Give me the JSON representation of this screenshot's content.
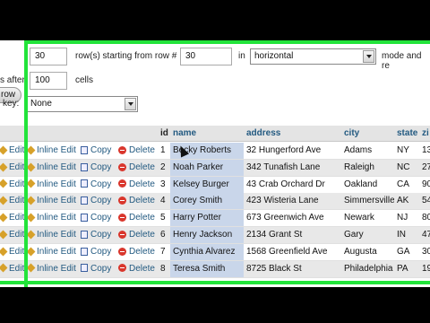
{
  "controls": {
    "nav_button": "row",
    "rows_value": "30",
    "rows_label": "row(s) starting from row #",
    "start_value": "30",
    "in_label": "in",
    "mode_value": "horizontal",
    "mode_label": "mode and re",
    "repeat_left_label": "s after",
    "repeat_value": "100",
    "cells_label": "cells",
    "key_label": "key:",
    "key_value": "None"
  },
  "table": {
    "headers": [
      "id",
      "name",
      "address",
      "city",
      "state",
      "zi"
    ],
    "action_labels": {
      "edit": "Edit",
      "inline_edit": "Inline Edit",
      "copy": "Copy",
      "delete": "Delete"
    },
    "rows": [
      {
        "id": "1",
        "name": "Becky Roberts",
        "address": "32 Hungerford Ave",
        "city": "Adams",
        "state": "NY",
        "zip": "13"
      },
      {
        "id": "2",
        "name": "Noah Parker",
        "address": "342 Tunafish Lane",
        "city": "Raleigh",
        "state": "NC",
        "zip": "27"
      },
      {
        "id": "3",
        "name": "Kelsey Burger",
        "address": "43 Crab Orchard Dr",
        "city": "Oakland",
        "state": "CA",
        "zip": "90"
      },
      {
        "id": "4",
        "name": "Corey Smith",
        "address": "423 Wisteria Lane",
        "city": "Simmersville",
        "state": "AK",
        "zip": "54"
      },
      {
        "id": "5",
        "name": "Harry Potter",
        "address": "673 Greenwich Ave",
        "city": "Newark",
        "state": "NJ",
        "zip": "80"
      },
      {
        "id": "6",
        "name": "Henry Jackson",
        "address": "2134 Grant St",
        "city": "Gary",
        "state": "IN",
        "zip": "47"
      },
      {
        "id": "7",
        "name": "Cynthia Alvarez",
        "address": "1568 Greenfield Ave",
        "city": "Augusta",
        "state": "GA",
        "zip": "30"
      },
      {
        "id": "8",
        "name": "Teresa Smith",
        "address": "8725 Black St",
        "city": "Philadelphia",
        "state": "PA",
        "zip": "19"
      }
    ]
  },
  "colors": {
    "frame": "#22e43a",
    "link": "#235a81",
    "selected_name": "#c9d6ea"
  }
}
